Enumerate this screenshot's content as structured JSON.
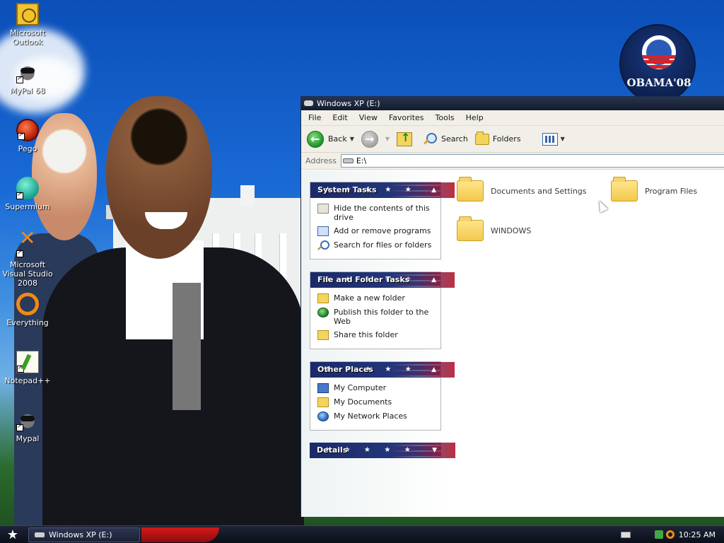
{
  "desktop": {
    "icons": [
      {
        "label": "Microsoft Outlook",
        "icon": "outlook-icon"
      },
      {
        "label": "MyPal 68",
        "icon": "mypal-icon"
      },
      {
        "label": "Pego",
        "icon": "pego-icon"
      },
      {
        "label": "Supermium",
        "icon": "supermium-icon"
      },
      {
        "label": "Microsoft Visual Studio 2008",
        "icon": "visual-studio-icon"
      },
      {
        "label": "Everything",
        "icon": "everything-icon"
      },
      {
        "label": "Notepad++",
        "icon": "notepadpp-icon"
      },
      {
        "label": "Mypal",
        "icon": "mypal-icon"
      }
    ],
    "wallpaper_logo_text": "OBAMA'08"
  },
  "window": {
    "title": "Windows XP (E:)",
    "menu": [
      "File",
      "Edit",
      "View",
      "Favorites",
      "Tools",
      "Help"
    ],
    "toolbar": {
      "back": "Back",
      "search": "Search",
      "folders": "Folders"
    },
    "address": {
      "label": "Address",
      "value": "E:\\"
    },
    "panels": {
      "system_tasks": {
        "title": "System Tasks",
        "items": [
          "Hide the contents of this drive",
          "Add or remove programs",
          "Search for files or folders"
        ]
      },
      "file_folder_tasks": {
        "title": "File and Folder Tasks",
        "items": [
          "Make a new folder",
          "Publish this folder to the Web",
          "Share this folder"
        ]
      },
      "other_places": {
        "title": "Other Places",
        "items": [
          "My Computer",
          "My Documents",
          "My Network Places"
        ]
      },
      "details": {
        "title": "Details"
      }
    },
    "folders": [
      "Documents and Settings",
      "Program Files",
      "WINDOWS"
    ]
  },
  "taskbar": {
    "task_button": "Windows XP (E:)",
    "clock": "10:25 AM"
  },
  "colors": {
    "titlebar": "#141c2e",
    "panel_blue": "#1a2a6a",
    "panel_red": "#b8162c",
    "taskbar": "#0b0f1a"
  }
}
